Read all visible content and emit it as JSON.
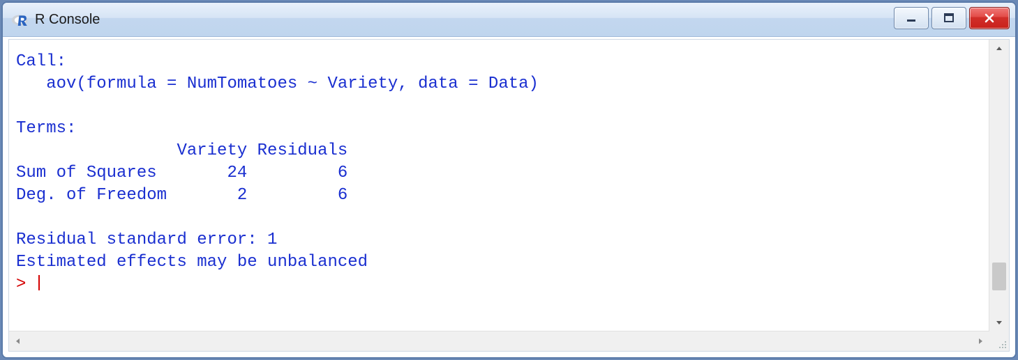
{
  "window": {
    "title": "R Console",
    "icon": "r-logo-icon"
  },
  "controls": {
    "minimize": "minimize-icon",
    "maximize": "maximize-icon",
    "close": "close-icon"
  },
  "console": {
    "lines": {
      "l0": "Call:",
      "l1": "   aov(formula = NumTomatoes ~ Variety, data = Data)",
      "l2": "",
      "l3": "Terms:",
      "l4": "                Variety Residuals",
      "l5": "Sum of Squares       24         6",
      "l6": "Deg. of Freedom       2         6",
      "l7": "",
      "l8": "Residual standard error: 1",
      "l9": "Estimated effects may be unbalanced"
    },
    "prompt": "> "
  },
  "colors": {
    "console_text": "#1a2fd0",
    "prompt": "#d40000",
    "titlebar_top": "#e9f1fb",
    "titlebar_bottom": "#bfd5ee",
    "close_button": "#d12f2a"
  }
}
